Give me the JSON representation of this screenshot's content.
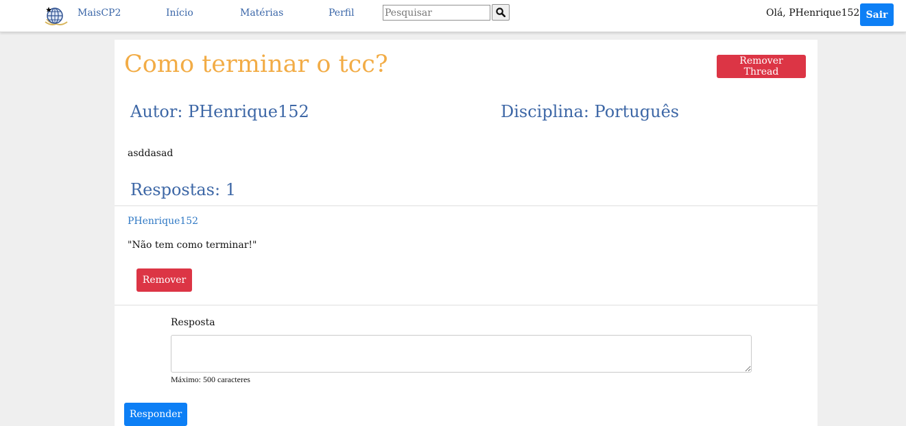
{
  "navbar": {
    "brand": "MaisCP2",
    "links": [
      "Início",
      "Matérias",
      "Perfil"
    ],
    "search": {
      "placeholder": "Pesquisar",
      "value": ""
    },
    "greeting": "Olá, PHenrique152",
    "logout_label": "Sair",
    "logo_icon": "globe-icon",
    "search_icon": "magnifier-icon"
  },
  "thread": {
    "title": "Como terminar o tcc?",
    "remove_label": "Remover Thread",
    "author_line": "Autor: PHenrique152",
    "subject_line": "Disciplina: Português",
    "body": "asddasad",
    "replies_heading": "Respostas: 1"
  },
  "replies": [
    {
      "author": "PHenrique152",
      "text": "\"Não tem como terminar!\"",
      "remove_label": "Remover"
    }
  ],
  "reply_form": {
    "label": "Resposta",
    "value": "",
    "hint": "Máximo: 500 caracteres",
    "submit_label": "Responder"
  },
  "colors": {
    "title": "#f2ac46",
    "heading": "#3d67a6",
    "primary": "#0d7ff5",
    "danger": "#dc3545",
    "link": "#2f78c4"
  }
}
